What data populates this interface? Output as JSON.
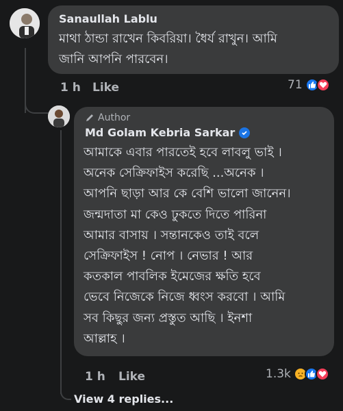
{
  "comment1": {
    "author": "Sanaullah Lablu",
    "text": "মাথা ঠান্ডা রাখেন কিবরিয়া। ধৈর্য রাখুন। আমি\nজানি আপনি পারবেন।",
    "time": "1 h",
    "like_label": "Like",
    "reaction_count": "71",
    "reactions": [
      "like-icon",
      "love-icon"
    ]
  },
  "reply": {
    "badge": "Author",
    "author": "Md Golam Kebria Sarkar",
    "text": "আমাকে এবার পারতেই হবে লাবলু ভাই ।\nঅনেক সেক্রিফাইস করেছি ...অনেক ।\nআপনি ছাড়া আর কে বেশি ভালো জানেন।\nজন্মদাতা মা কেও ঢুকতে দিতে পারিনা\nআমার বাসায় । সন্তানকেও তাই বলে\nসেক্রিফাইস ! নোপ । নেভার ! আর\nকতকাল পাবলিক ইমেজের ক্ষতি হবে\nভেবে নিজেকে নিজে ধ্বংস করবো । আমি\nসব কিছুর জন্য প্রস্তুত আছি । ইনশা\nআল্লাহ ।",
    "time": "1 h",
    "like_label": "Like",
    "reaction_count": "1.3k",
    "reactions": [
      "sad-icon",
      "like-icon",
      "love-icon"
    ]
  },
  "view_replies": "View 4 replies...",
  "colors": {
    "background": "#18191a",
    "bubble": "#3a3b3c",
    "like_blue": "#1877f2",
    "love_red": "#f33e58",
    "sad_yellow": "#f7b125",
    "verified": "#1b74e4"
  }
}
